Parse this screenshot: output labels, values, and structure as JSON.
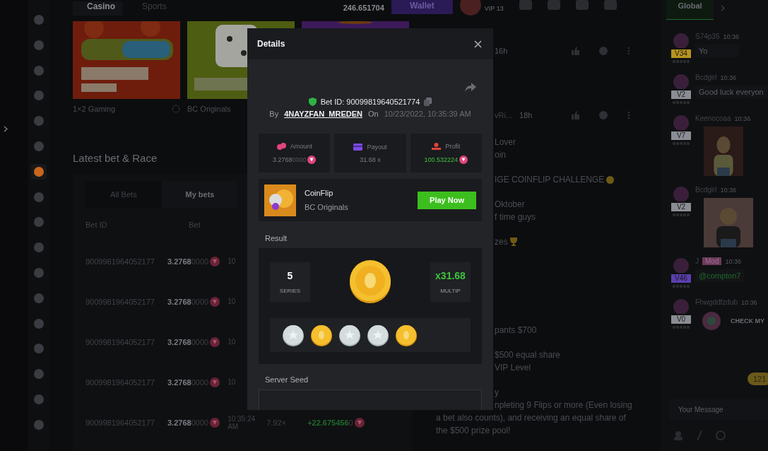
{
  "sidebar": {
    "items": [
      {
        "selected": false
      },
      {
        "selected": false
      },
      {
        "selected": false
      },
      {
        "selected": false
      },
      {
        "selected": false
      },
      {
        "selected": false
      },
      {
        "selected": true
      },
      {
        "selected": false
      },
      {
        "selected": false
      },
      {
        "selected": false
      },
      {
        "selected": false
      },
      {
        "selected": false
      },
      {
        "selected": false
      },
      {
        "selected": false
      },
      {
        "selected": false
      },
      {
        "selected": false
      },
      {
        "selected": false
      }
    ]
  },
  "topbar": {
    "tabs": [
      {
        "label": "Casino",
        "selected": true
      },
      {
        "label": "Sports",
        "selected": false
      }
    ],
    "balance": "246.651704",
    "wallet": "Wallet",
    "vip": "VIP 13"
  },
  "games": [
    {
      "provider": "1×2 Gaming",
      "kind": "fruit"
    },
    {
      "provider": "BC Originals",
      "kind": "dice"
    },
    {
      "kind": "purple"
    }
  ],
  "latest": {
    "title": "Latest bet & Race",
    "tabs": [
      {
        "label": "All Bets",
        "selected": false
      },
      {
        "label": "My bets",
        "selected": true
      }
    ],
    "columns": [
      "Bet ID",
      "Bet"
    ],
    "rows": [
      {
        "bet_id": "9009981964052177",
        "amount": "3.2768",
        "amount_tail": "0000",
        "time": "10"
      },
      {
        "bet_id": "9009981964052177",
        "amount": "3.2768",
        "amount_tail": "0000",
        "time": "10"
      },
      {
        "bet_id": "9009981964052177",
        "amount": "3.2768",
        "amount_tail": "0000",
        "time": "10"
      },
      {
        "bet_id": "9009981964052177",
        "amount": "3.2768",
        "amount_tail": "0000",
        "time": "10"
      },
      {
        "bet_id": "9009981964052177",
        "amount": "3.2768",
        "amount_tail": "0000",
        "time": "10:35:24 AM",
        "payout": "7.92×",
        "profit": "+22.675456",
        "profit_tail": "0"
      }
    ]
  },
  "forum": {
    "posts": [
      {
        "age": "16h"
      },
      {
        "author": "vRi...",
        "age": "18h"
      }
    ],
    "paragraphs": [
      {
        "lines": [
          {
            "text": "Lover",
            "kind": "partial"
          },
          {
            "text": "oin",
            "kind": "partial"
          }
        ]
      },
      {
        "lines": [
          {
            "text": "IGE COINFLIP CHALLENGE",
            "kind": "partial"
          }
        ]
      },
      {
        "lines": [
          {
            "text": "Oktober",
            "kind": "partial"
          },
          {
            "text": "f time guys",
            "kind": "partial"
          }
        ]
      },
      {
        "lines": [
          {
            "text": "zes",
            "kind": "partial"
          }
        ]
      },
      {
        "lines": [
          {
            "text": "pants $700",
            "kind": "partial"
          }
        ]
      },
      {
        "lines": [
          {
            "text": "$500 equal share",
            "kind": "partial"
          },
          {
            "text": "VIP Level",
            "kind": "partial"
          }
        ]
      },
      {
        "lines": [
          {
            "text": "y",
            "kind": "partial"
          },
          {
            "text": "npleting 9 Flips or more (Even losing",
            "kind": "partial"
          },
          {
            "text": "a bet also counts), and receiving an equal share of",
            "kind": "full"
          },
          {
            "text": "the $500 prize pool!",
            "kind": "full"
          }
        ]
      }
    ]
  },
  "chat": {
    "tab": "Global",
    "messages": [
      {
        "name": "S74p35",
        "time": "10:36",
        "level": "V34",
        "color": "#b8941f",
        "kind": "text",
        "text": "Yo"
      },
      {
        "name": "Bcdgirl",
        "time": "10:36",
        "level": "V2",
        "color": "#8a8d93",
        "kind": "text",
        "text": "Good luck everyon"
      },
      {
        "name": "Keenocoaa",
        "time": "10:36",
        "level": "V7",
        "color": "#8a8d93",
        "kind": "picture"
      },
      {
        "name": "Bcdgirl",
        "time": "10:36",
        "level": "V2",
        "color": "#8a8d93",
        "kind": "picture"
      },
      {
        "name": "J",
        "badge": "Mod",
        "time": "10:36",
        "level": "V46",
        "color": "#5b3fb0",
        "kind": "mention",
        "text": "@compton7"
      },
      {
        "name": "Fhwgddfzdub",
        "time": "10:36",
        "level": "V0",
        "color": "#8a8d93",
        "kind": "card",
        "text": "CHECK MY"
      }
    ],
    "unread": "121",
    "placeholder": "Your Message"
  },
  "modal": {
    "title": "Details",
    "bet_id": "Bet ID: 90099819640521774",
    "by": "By",
    "user": "4NAYZFAN_MREDEN",
    "on": "On",
    "date": "10/23/2022, 10:35:39 AM",
    "stats": [
      {
        "label": "Amount",
        "value": "3.2768",
        "tail": "0000",
        "coin": true,
        "kind": "amount"
      },
      {
        "label": "Payout",
        "value": "31.68 x",
        "coin": false,
        "kind": "payout"
      },
      {
        "label": "Profit",
        "value": "100.532224",
        "coin": true,
        "kind": "profit"
      }
    ],
    "game": {
      "name": "CoinFlip",
      "provider": "BC Originals",
      "button": "Play Now"
    },
    "result_label": "Result",
    "series": "5",
    "series_label": "SERIES",
    "multiplier": "x31.68",
    "multiplier_label": "MULTIP",
    "coins": [
      {
        "kind": "silver"
      },
      {
        "kind": "gold"
      },
      {
        "kind": "silver"
      },
      {
        "kind": "silver"
      },
      {
        "kind": "gold"
      }
    ],
    "seed_label": "Server Seed"
  }
}
